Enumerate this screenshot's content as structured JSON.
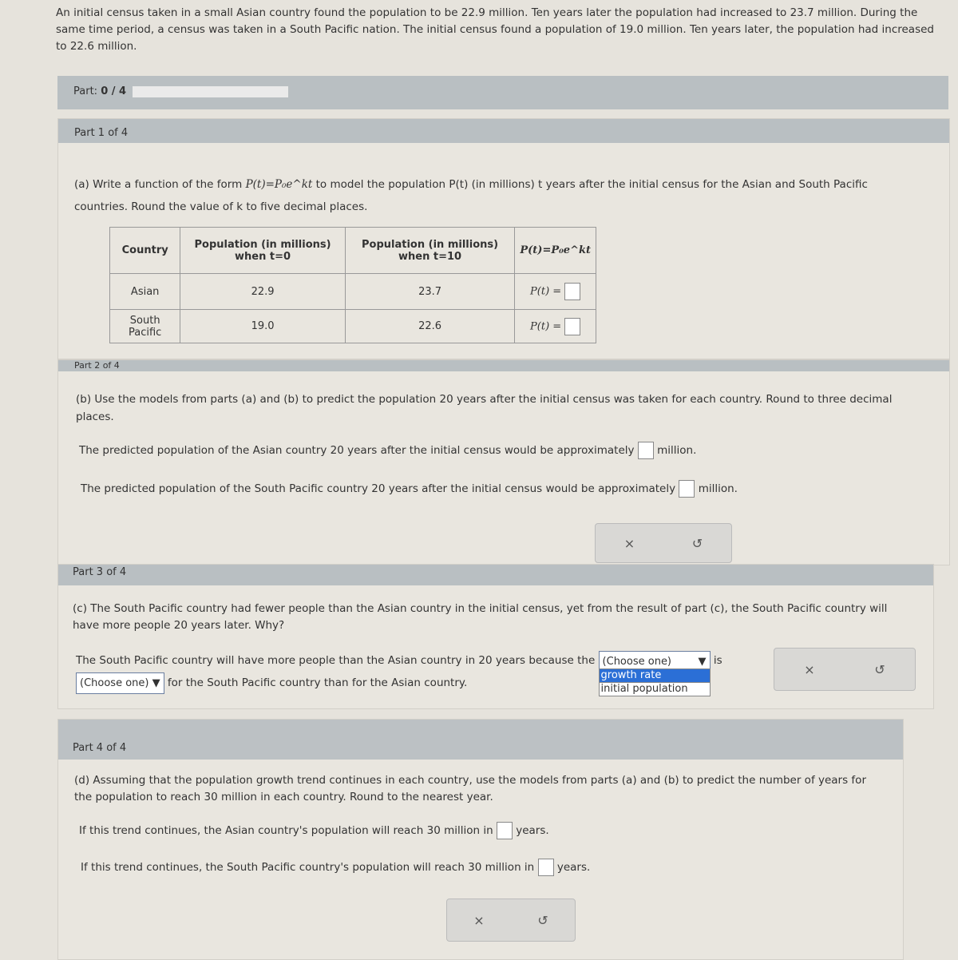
{
  "intro": "An initial census taken in a small Asian country found the population to be 22.9 million. Ten years later the population had increased to 23.7 million. During the same time period, a census was taken in a South Pacific nation. The initial census found a population of 19.0 million. Ten years later, the population had increased to 22.6 million.",
  "progress": {
    "label": "Part:",
    "value": "0 / 4",
    "fraction": 0
  },
  "part1": {
    "label": "Part 1 of 4",
    "q_pre": "(a) Write a function of the form",
    "formula": "P(t)=P₀e^kt",
    "q_post": "to model the population P(t) (in millions) t years after the initial census for the Asian and South Pacific countries. Round the value of k to five decimal places.",
    "headers": [
      "Country",
      "Population (in millions) when t=0",
      "Population (in millions) when t=10",
      "P(t)=P₀e^kt"
    ],
    "rows": [
      {
        "country": "Asian",
        "p0": "22.9",
        "p10": "23.7",
        "eq": "P(t) ="
      },
      {
        "country": "South Pacific",
        "p0": "19.0",
        "p10": "22.6",
        "eq": "P(t) ="
      }
    ]
  },
  "part2": {
    "label": "Part 2 of 4",
    "question": "(b) Use the models from parts (a) and (b) to predict the population 20 years after the initial census was taken for each country. Round to three decimal places.",
    "line1": "The predicted population of the Asian country 20 years after the initial census would be approximately",
    "line2": "The predicted population of the South Pacific country 20 years after the initial census would be approximately",
    "unit": "million."
  },
  "part3": {
    "label": "Part 3 of 4",
    "question": "(c) The South Pacific country had fewer people than the Asian country in the initial census, yet from the result of part (c), the South Pacific country will have more people 20 years later. Why?",
    "pre": "The South Pacific country will have more people than the Asian country in 20 years because the",
    "select1": "(Choose one)",
    "mid": "is",
    "select2": "(Choose one)",
    "post": "for the South Pacific country than for the Asian country.",
    "options": [
      "growth rate",
      "initial population"
    ]
  },
  "part4": {
    "label": "Part 4 of 4",
    "question": "(d) Assuming that the population growth trend continues in each country, use the models from parts (a) and (b) to predict the number of years for the population to reach 30 million in each country. Round to the nearest year.",
    "line1": "If this trend continues, the Asian country's population will reach 30 million in",
    "line2": "If this trend continues, the South Pacific country's population will reach 30 million in",
    "unit": "years."
  },
  "buttons": {
    "clear": "×",
    "undo": "↺"
  }
}
